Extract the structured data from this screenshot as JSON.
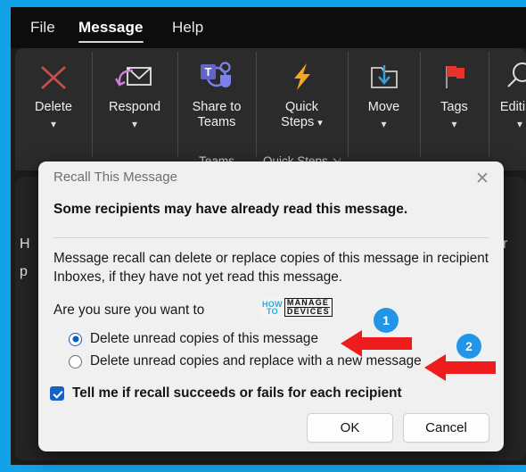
{
  "window": {
    "frame_color": "#12a2e8",
    "background": "#1b1b1b"
  },
  "tabs": [
    {
      "label": "File",
      "active": false
    },
    {
      "label": "Message",
      "active": true
    },
    {
      "label": "Help",
      "active": false
    }
  ],
  "ribbon": {
    "groups": [
      {
        "icon": "delete-x-icon",
        "label": "Delete",
        "label2": "",
        "has_chevron": true,
        "group_label": "",
        "icon_color": "#c94f4f"
      },
      {
        "icon": "respond-envelope-reply-icon",
        "label": "Respond",
        "label2": "",
        "has_chevron": true,
        "group_label": "",
        "icon_color": "#d07fd8"
      },
      {
        "icon": "microsoft-teams-icon",
        "label": "Share to",
        "label2": "Teams",
        "has_chevron": false,
        "group_label": "Teams",
        "icon_color": "#7b83eb"
      },
      {
        "icon": "quick-steps-lightning-icon",
        "label": "Quick",
        "label2": "Steps",
        "has_chevron": true,
        "inline_chevron": true,
        "group_label": "Quick Steps",
        "group_launcher": "dialog-box-launcher-icon",
        "icon_color": "#f5a623"
      },
      {
        "icon": "move-folder-arrow-icon",
        "label": "Move",
        "label2": "",
        "has_chevron": true,
        "group_label": "",
        "icon_color": "#cfcfcf"
      },
      {
        "icon": "tags-flag-icon",
        "label": "Tags",
        "label2": "",
        "has_chevron": true,
        "group_label": "",
        "icon_color": "#e8332a"
      },
      {
        "icon": "editing-magnifier-icon",
        "label": "Editing",
        "label2": "",
        "has_chevron": true,
        "group_label": "",
        "icon_color": "#dcdcdc"
      }
    ]
  },
  "reading_pane": {
    "line_1": "H",
    "line_2": "p",
    "line_right": "cr"
  },
  "dialog": {
    "title": "Recall This Message",
    "close_icon": "close-icon",
    "heading": "Some recipients may have already read this message.",
    "paragraph": "Message recall can delete or replace copies of this message in recipient Inboxes, if they have not yet read this message.",
    "question": "Are you sure you want to",
    "options": [
      {
        "label": "Delete unread copies of this message",
        "checked": true
      },
      {
        "label": "Delete unread copies and replace with a new message",
        "checked": false
      }
    ],
    "checkbox": {
      "label": "Tell me if recall succeeds or fails for each recipient",
      "checked": true
    },
    "buttons": {
      "ok": "OK",
      "cancel": "Cancel"
    },
    "accent_color": "#1363c6"
  },
  "watermark": {
    "how": "HOW",
    "to": "TO",
    "manage": "MANAGE",
    "devices": "DEVICES",
    "accent": "#22b0e8"
  },
  "annotations": {
    "badges": [
      {
        "number": "1",
        "color": "#2196e8"
      },
      {
        "number": "2",
        "color": "#2196e8"
      }
    ],
    "arrow_color": "#ee1c1c"
  }
}
